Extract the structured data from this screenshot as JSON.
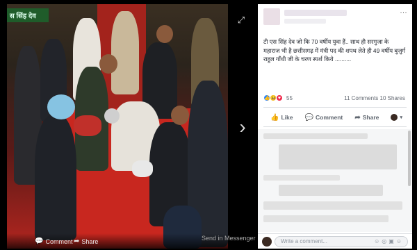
{
  "photo": {
    "banner_text": "स सिंह देव",
    "actions": {
      "comment_label": "Comment",
      "share_label": "Share",
      "send_label": "Send in Messenger"
    }
  },
  "post": {
    "text": "टी एस सिंह देव जो कि 70 वर्षीय युवा हैं.. साथ ही सरगुजा के महाराज भी है छत्तीसगढ़ में मंत्री पद की शपथ लेते ही 49 वर्षीय बुजुर्ग राहुल गाँधी जी के चरण स्पर्श किये ..........",
    "reactions_count": "55",
    "comments_count": "11 Comments",
    "shares_count": "10 Shares",
    "actions": {
      "like_label": "Like",
      "comment_label": "Comment",
      "share_label": "Share"
    },
    "write_placeholder": "Write a comment...",
    "more_icon": "…"
  },
  "colors": {
    "fb_blue": "#2d88ff",
    "carpet_red": "#c8271f"
  }
}
